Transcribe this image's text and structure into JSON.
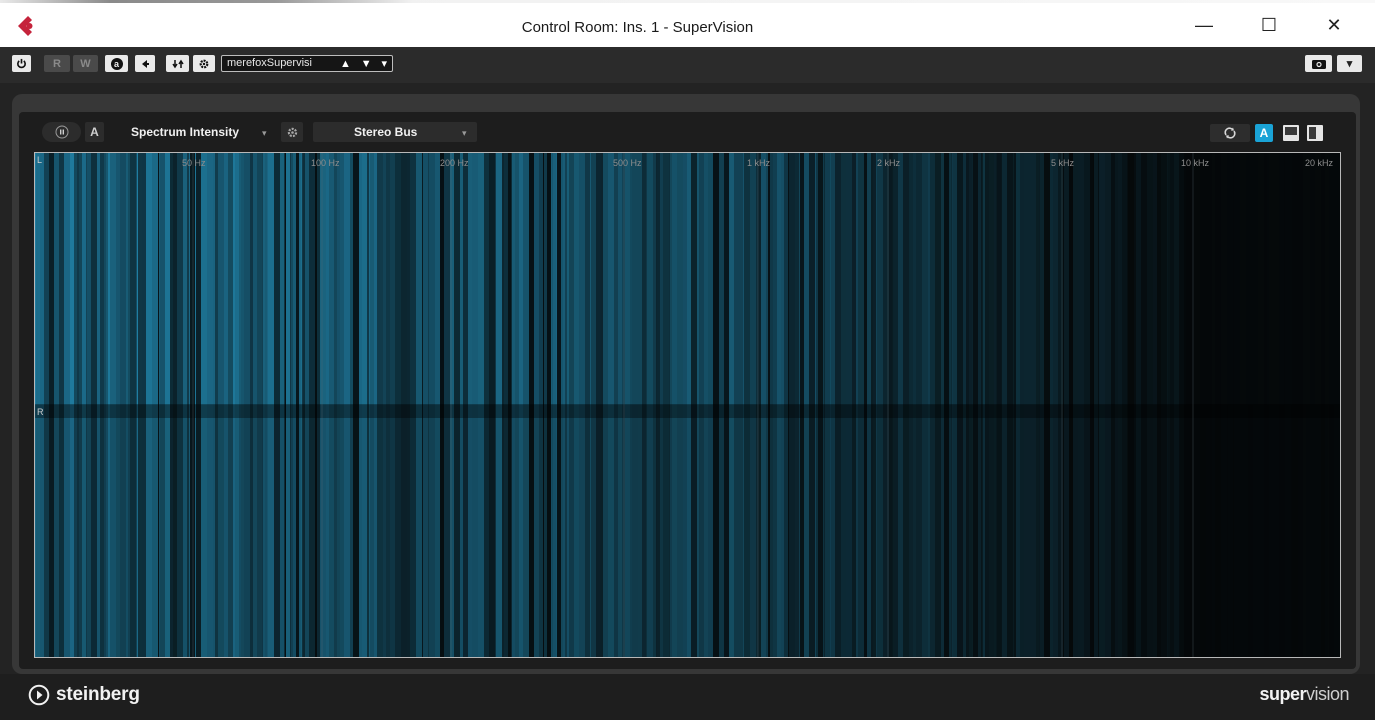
{
  "window": {
    "title": "Control Room: Ins. 1 - SuperVision",
    "minimize_glyph": "—",
    "maximize_glyph": "☐",
    "close_glyph": "✕"
  },
  "toolbar": {
    "read_label": "R",
    "write_label": "W",
    "auto_label": "a",
    "preset_name": "merefoxSupervisi",
    "preset_up": "▲",
    "preset_down": "▼",
    "preset_menu": "▾",
    "menu_caret": "▾"
  },
  "module": {
    "a_label": "A",
    "display_type": "Spectrum Intensity",
    "source": "Stereo Bus",
    "a_toggle_label": "A"
  },
  "display": {
    "freq_labels": [
      "50 Hz",
      "100 Hz",
      "200 Hz",
      "500 Hz",
      "1 kHz",
      "2 kHz",
      "5 kHz",
      "10 kHz",
      "20 kHz"
    ],
    "channel_left": "L",
    "channel_right": "R",
    "accent": "#2aa8d8"
  },
  "footer": {
    "brand": "steinberg",
    "product_bold": "super",
    "product_light": "vision"
  },
  "icons": [
    "cubase-logo-icon",
    "power-icon",
    "arrow-left-icon",
    "compare-icon",
    "gear-icon",
    "camera-icon",
    "pause-icon",
    "settings-icon",
    "sync-icon",
    "layout-bottom-icon",
    "layout-right-icon",
    "steinberg-logo-icon"
  ]
}
